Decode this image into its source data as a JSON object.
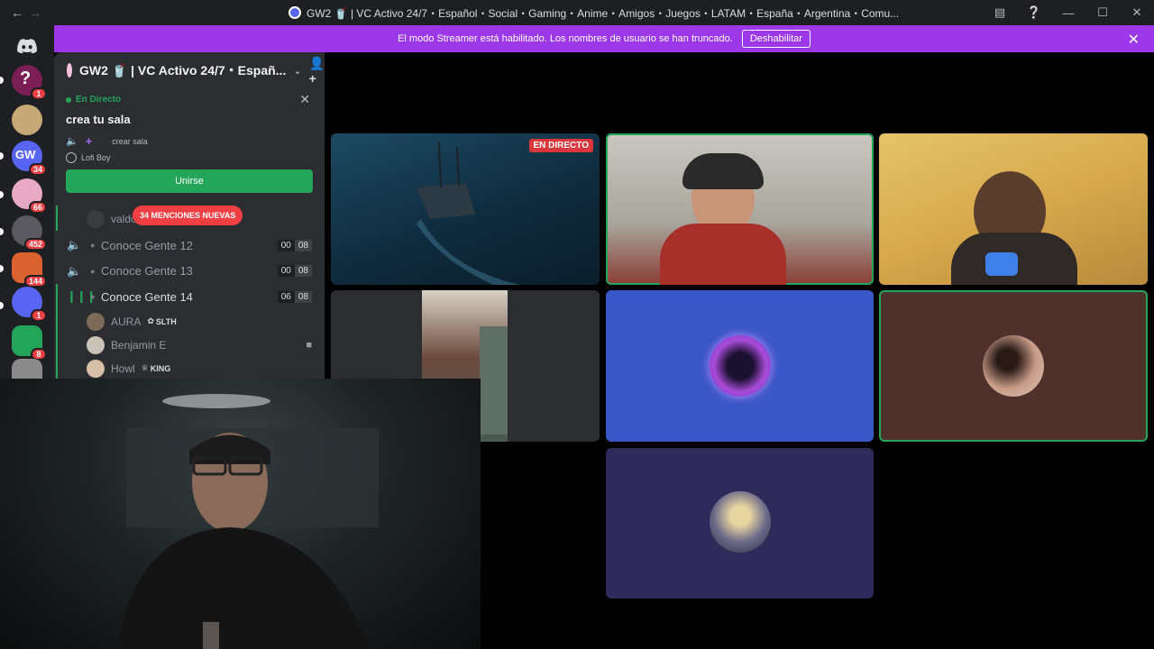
{
  "titlebar": {
    "back_icon": "arrow-left-icon",
    "forward_icon": "arrow-right-icon",
    "title": "GW2 🥤 | VC Activo 24/7・Español・Social・Gaming・Anime・Amigos・Juegos・LATAM・España・Argentina・Comu...",
    "icons": [
      "inbox-icon",
      "help-icon",
      "minimize-icon",
      "maximize-icon",
      "close-icon"
    ]
  },
  "rail": {
    "guilds": [
      {
        "name": "guild-question",
        "badge": "1",
        "color": "#7a1e55"
      },
      {
        "name": "guild-cat",
        "badge": "",
        "color": "#c7a978"
      },
      {
        "name": "guild-gw2",
        "badge": "34",
        "color": "#5865f2"
      },
      {
        "name": "guild-anime-1",
        "badge": "66",
        "color": "#e8a9c4"
      },
      {
        "name": "guild-anime-2",
        "badge": "452",
        "color": "#5a5a60"
      },
      {
        "name": "guild-collage",
        "badge": "144",
        "color": "#d9622e"
      },
      {
        "name": "guild-discord",
        "badge": "1",
        "color": "#5865f2"
      },
      {
        "name": "guild-creeper",
        "badge": "8",
        "color": "#23a55a"
      },
      {
        "name": "guild-manga",
        "badge": "",
        "color": "#8a8a8a"
      }
    ]
  },
  "banner": {
    "text": "El modo Streamer está habilitado. Los nombres de usuario se han truncado.",
    "button": "Deshabilitar"
  },
  "server": {
    "name": "GW2 🥤 | VC Activo 24/7・Españ..."
  },
  "live": {
    "status": "En Directo",
    "stage_title": "crea tu sala",
    "stage_channel": "crear sala",
    "music": "Lofi Boy",
    "join": "Unirse"
  },
  "mentions": "34 MENCIONES NUEVAS",
  "channels": {
    "top_user": "valdo",
    "items": [
      {
        "name": "Conoce Gente 12",
        "count": "00",
        "limit": "08",
        "live": false
      },
      {
        "name": "Conoce Gente 13",
        "count": "00",
        "limit": "08",
        "live": false
      },
      {
        "name": "Conoce Gente 14",
        "count": "06",
        "limit": "08",
        "live": true
      }
    ],
    "users": [
      {
        "name": "AURA",
        "tag": "SLTH",
        "tag_icon": "leaf-icon",
        "camera": false,
        "color": "#7d6a58"
      },
      {
        "name": "Benjamin E",
        "tag": "",
        "tag_icon": "",
        "camera": true,
        "color": "#c9c3b8"
      },
      {
        "name": "Howl",
        "tag": "KING",
        "tag_icon": "crown-icon",
        "camera": false,
        "color": "#d8c0a8"
      }
    ]
  },
  "videos": {
    "live_label": "EN DIRECTO",
    "colors": {
      "game": "#14344a",
      "cam_blue": "#3a57c7",
      "cam_brown": "#4e312a",
      "cam_purple": "#2e2a5a"
    }
  }
}
